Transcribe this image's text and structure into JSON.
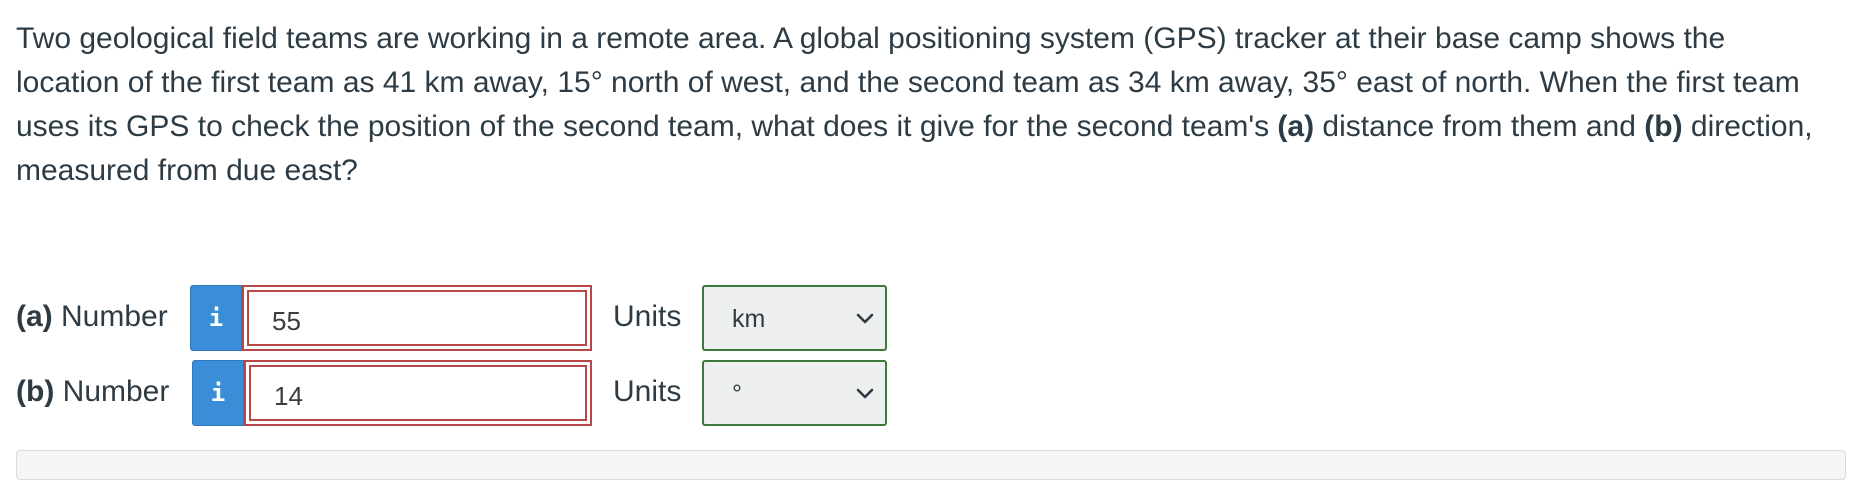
{
  "question": {
    "text_1": "Two geological field teams are working in a remote area. A global positioning system (GPS) tracker at their base camp shows the location of the first team as 41 km away, 15° north of west, and the second team as 34 km away, 35° east of north. When the first team uses its GPS to check the position of the second team, what does it give for the second team's ",
    "part_a_marker": "(a)",
    "text_2": " distance from them and ",
    "part_b_marker": "(b)",
    "text_3": " direction, measured from due east?"
  },
  "parts": [
    {
      "marker": "(a)",
      "label": " Number",
      "info_icon": "i",
      "value": "55",
      "units_label": "Units",
      "units_value": "km"
    },
    {
      "marker": "(b)",
      "label": " Number",
      "info_icon": "i",
      "value": "14",
      "units_label": "Units",
      "units_value": "°"
    }
  ],
  "colors": {
    "info_button": "#3a8ed8",
    "incorrect_border": "#b8474a",
    "select_border": "#3c7a3c",
    "text": "#2d3b45"
  },
  "icons": {
    "info": "info-icon",
    "select_arrow": "chevron-down-icon"
  }
}
